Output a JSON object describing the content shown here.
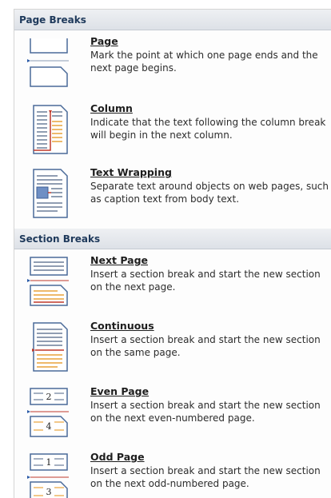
{
  "page_breaks": {
    "header": "Page Breaks",
    "items": [
      {
        "title": "Page",
        "desc": "Mark the point at which one page ends and the next page begins.",
        "icon": "page-break-icon"
      },
      {
        "title": "Column",
        "desc": "Indicate that the text following the column break will begin in the next column.",
        "icon": "column-break-icon"
      },
      {
        "title": "Text Wrapping",
        "desc": "Separate text around objects on web pages, such as caption text from body text.",
        "icon": "text-wrapping-icon"
      }
    ]
  },
  "section_breaks": {
    "header": "Section Breaks",
    "items": [
      {
        "title": "Next Page",
        "desc": "Insert a section break and start the new section on the next page.",
        "icon": "next-page-icon"
      },
      {
        "title": "Continuous",
        "desc": "Insert a section break and start the new section on the same page.",
        "icon": "continuous-icon"
      },
      {
        "title": "Even Page",
        "desc": "Insert a section break and start the new section on the next even-numbered page.",
        "icon": "even-page-icon",
        "numbers": [
          "2",
          "4"
        ]
      },
      {
        "title": "Odd Page",
        "desc": "Insert a section break and start the new section on the next odd-numbered page.",
        "icon": "odd-page-icon",
        "numbers": [
          "1",
          "3"
        ]
      }
    ]
  },
  "colors": {
    "accent": "#2b5aa6",
    "marker": "#c0392b",
    "highlight": "#e8a23a"
  }
}
